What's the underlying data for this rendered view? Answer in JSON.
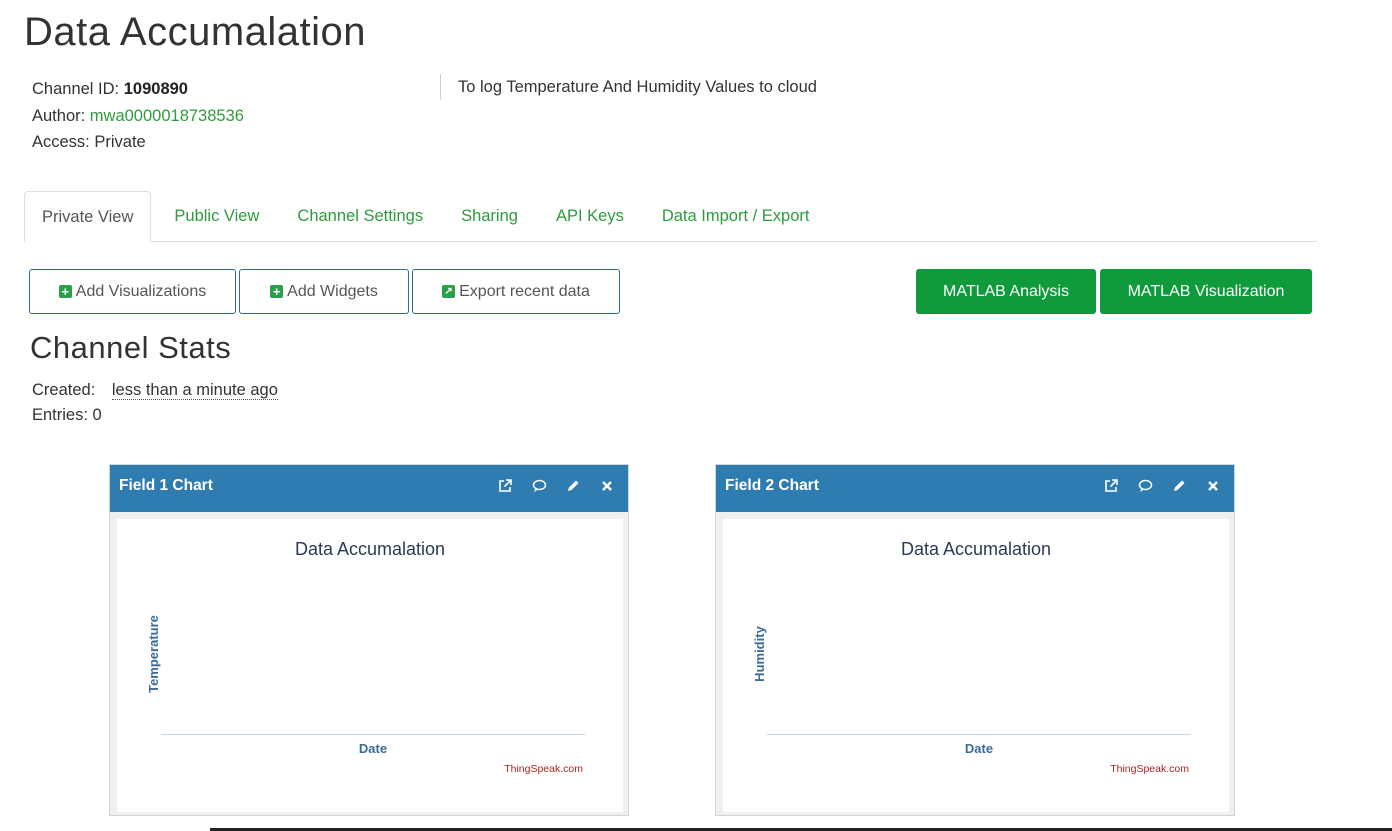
{
  "page": {
    "title": "Data Accumalation",
    "channel_id_label": "Channel ID:",
    "channel_id": "1090890",
    "author_label": "Author:",
    "author": "mwa0000018738536",
    "access_label": "Access:",
    "access": "Private",
    "description": "To log Temperature And Humidity Values to cloud"
  },
  "tabs": [
    {
      "label": "Private View",
      "active": true
    },
    {
      "label": "Public View"
    },
    {
      "label": "Channel Settings"
    },
    {
      "label": "Sharing"
    },
    {
      "label": "API Keys"
    },
    {
      "label": "Data Import / Export"
    }
  ],
  "actions": {
    "add_visualizations": "Add Visualizations",
    "add_widgets": "Add Widgets",
    "export_recent_data": "Export recent data",
    "matlab_analysis": "MATLAB Analysis",
    "matlab_visualization": "MATLAB Visualization"
  },
  "stats": {
    "title": "Channel Stats",
    "created_label": "Created:",
    "created_value": "less than a minute ago",
    "entries_label": "Entries:",
    "entries_value": "0"
  },
  "charts": [
    {
      "panel_title": "Field 1 Chart",
      "chart_title": "Data Accumalation",
      "ylabel": "Temperature",
      "xlabel": "Date",
      "credit": "ThingSpeak.com"
    },
    {
      "panel_title": "Field 2 Chart",
      "chart_title": "Data Accumalation",
      "ylabel": "Humidity",
      "xlabel": "Date",
      "credit": "ThingSpeak.com"
    }
  ],
  "colors": {
    "accent_green": "#0f9a3b",
    "link_green": "#2d9c3c",
    "panel_header_blue": "#2f7db0"
  }
}
